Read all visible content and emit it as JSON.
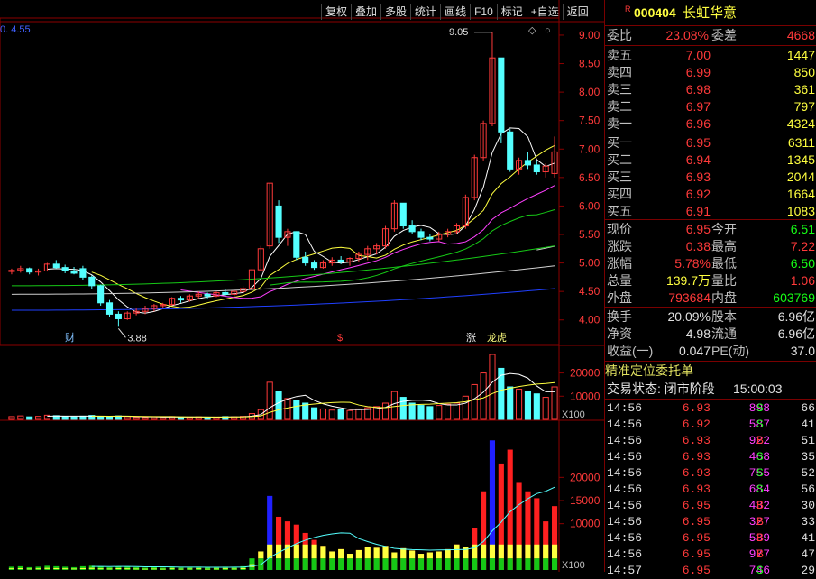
{
  "toolbar": [
    "复权",
    "叠加",
    "多股",
    "统计",
    "画线",
    "F10",
    "标记",
    "+自选",
    "返回"
  ],
  "corner_value": "0. 4.55",
  "stock": {
    "code": "000404",
    "name": "长虹华意",
    "tag": "R"
  },
  "weibi": {
    "label": "委比",
    "value": "23.08%",
    "label2": "委差",
    "value2": "4668"
  },
  "sells": [
    {
      "label": "卖五",
      "price": "7.00",
      "vol": "1447"
    },
    {
      "label": "卖四",
      "price": "6.99",
      "vol": "850"
    },
    {
      "label": "卖三",
      "price": "6.98",
      "vol": "361"
    },
    {
      "label": "卖二",
      "price": "6.97",
      "vol": "797"
    },
    {
      "label": "卖一",
      "price": "6.96",
      "vol": "4324"
    }
  ],
  "buys": [
    {
      "label": "买一",
      "price": "6.95",
      "vol": "6311"
    },
    {
      "label": "买二",
      "price": "6.94",
      "vol": "1345"
    },
    {
      "label": "买三",
      "price": "6.93",
      "vol": "2044"
    },
    {
      "label": "买四",
      "price": "6.92",
      "vol": "1664"
    },
    {
      "label": "买五",
      "price": "6.91",
      "vol": "1083"
    }
  ],
  "quote": [
    {
      "l1": "现价",
      "v1": "6.95",
      "l2": "今开",
      "v2": "6.51"
    },
    {
      "l1": "涨跌",
      "v1": "0.38",
      "l2": "最高",
      "v2": "7.22"
    },
    {
      "l1": "涨幅",
      "v1": "5.78%",
      "l2": "最低",
      "v2": "6.50"
    },
    {
      "l1": "总量",
      "v1": "139.7万",
      "l2": "量比",
      "v2": "1.06"
    },
    {
      "l1": "外盘",
      "v1": "793684",
      "l2": "内盘",
      "v2": "603769"
    }
  ],
  "fin": [
    {
      "l1": "换手",
      "v1": "20.09%",
      "l2": "股本",
      "v2": "6.96亿"
    },
    {
      "l1": "净资",
      "v1": "4.98",
      "l2": "流通",
      "v2": "6.96亿"
    },
    {
      "l1": "收益(一)",
      "v1": "0.047",
      "l2": "PE(动)",
      "v2": "37.0"
    }
  ],
  "precise_title": "精准定位委托单",
  "trade_state": {
    "label": "交易状态: 闭市阶段",
    "time": "15:00:03"
  },
  "ticks": [
    {
      "t": "14:56",
      "p": "6.93",
      "v": "898",
      "s": "S",
      "n": "66"
    },
    {
      "t": "14:56",
      "p": "6.92",
      "v": "587",
      "s": "S",
      "n": "41"
    },
    {
      "t": "14:56",
      "p": "6.93",
      "v": "922",
      "s": "B",
      "n": "51"
    },
    {
      "t": "14:56",
      "p": "6.93",
      "v": "468",
      "s": "S",
      "n": "35"
    },
    {
      "t": "14:56",
      "p": "6.93",
      "v": "755",
      "s": "S",
      "n": "52"
    },
    {
      "t": "14:56",
      "p": "6.93",
      "v": "684",
      "s": "S",
      "n": "56"
    },
    {
      "t": "14:56",
      "p": "6.95",
      "v": "432",
      "s": "B",
      "n": "30"
    },
    {
      "t": "14:56",
      "p": "6.95",
      "v": "327",
      "s": "B",
      "n": "33"
    },
    {
      "t": "14:56",
      "p": "6.95",
      "v": "539",
      "s": "B",
      "n": "41"
    },
    {
      "t": "14:56",
      "p": "6.95",
      "v": "977",
      "s": "B",
      "n": "47"
    },
    {
      "t": "14:57",
      "p": "6.95",
      "v": "746",
      "s": "S",
      "n": "29"
    }
  ],
  "price_axis": [
    "9.00",
    "8.50",
    "8.00",
    "7.50",
    "7.00",
    "6.50",
    "6.00",
    "5.50",
    "5.00",
    "4.50",
    "4.00"
  ],
  "vol_axis": [
    "20000",
    "10000"
  ],
  "vol_unit": "X100",
  "ind_axis": [
    "20000",
    "15000",
    "10000"
  ],
  "ind_unit": "X100",
  "annot": {
    "high": "9.05",
    "low": "3.88",
    "m1": "财",
    "m2": "$",
    "m3": "涨",
    "m4": "龙虎"
  },
  "chart_data": {
    "type": "candlestick",
    "ylim": [
      3.6,
      9.3
    ],
    "candles": [
      [
        4.85,
        4.9,
        4.8,
        4.87
      ],
      [
        4.87,
        4.95,
        4.83,
        4.9
      ],
      [
        4.9,
        4.92,
        4.8,
        4.84
      ],
      [
        4.84,
        4.9,
        4.78,
        4.86
      ],
      [
        4.86,
        5.0,
        4.85,
        4.98
      ],
      [
        4.98,
        5.05,
        4.9,
        4.92
      ],
      [
        4.92,
        4.97,
        4.82,
        4.86
      ],
      [
        4.86,
        4.93,
        4.8,
        4.82
      ],
      [
        4.9,
        4.95,
        4.7,
        4.75
      ],
      [
        4.75,
        4.78,
        4.55,
        4.6
      ],
      [
        4.6,
        4.62,
        4.25,
        4.3
      ],
      [
        4.3,
        4.35,
        4.05,
        4.1
      ],
      [
        4.1,
        4.15,
        3.88,
        4.02
      ],
      [
        4.02,
        4.15,
        4.0,
        4.12
      ],
      [
        4.12,
        4.2,
        4.08,
        4.15
      ],
      [
        4.15,
        4.25,
        4.1,
        4.2
      ],
      [
        4.2,
        4.28,
        4.15,
        4.25
      ],
      [
        4.25,
        4.3,
        4.2,
        4.27
      ],
      [
        4.27,
        4.4,
        4.25,
        4.38
      ],
      [
        4.38,
        4.42,
        4.3,
        4.35
      ],
      [
        4.35,
        4.45,
        4.32,
        4.42
      ],
      [
        4.42,
        4.5,
        4.38,
        4.45
      ],
      [
        4.45,
        4.48,
        4.38,
        4.42
      ],
      [
        4.42,
        4.5,
        4.4,
        4.48
      ],
      [
        4.48,
        4.55,
        4.42,
        4.45
      ],
      [
        4.45,
        4.52,
        4.4,
        4.5
      ],
      [
        4.5,
        4.6,
        4.45,
        4.55
      ],
      [
        4.55,
        4.9,
        4.5,
        4.88
      ],
      [
        4.88,
        5.3,
        4.85,
        5.25
      ],
      [
        5.3,
        6.4,
        5.25,
        6.4
      ],
      [
        6.0,
        6.1,
        5.35,
        5.45
      ],
      [
        5.45,
        5.6,
        5.3,
        5.55
      ],
      [
        5.55,
        5.5,
        5.05,
        5.1
      ],
      [
        5.1,
        5.2,
        4.95,
        5.0
      ],
      [
        5.0,
        5.05,
        4.88,
        4.92
      ],
      [
        4.92,
        5.05,
        4.9,
        5.0
      ],
      [
        5.0,
        5.1,
        4.95,
        5.05
      ],
      [
        5.05,
        5.12,
        4.98,
        5.02
      ],
      [
        5.02,
        5.1,
        4.95,
        5.08
      ],
      [
        5.08,
        5.2,
        5.02,
        5.15
      ],
      [
        5.15,
        5.3,
        5.05,
        5.25
      ],
      [
        5.25,
        5.35,
        5.15,
        5.3
      ],
      [
        5.3,
        5.65,
        5.25,
        5.6
      ],
      [
        5.6,
        6.1,
        5.55,
        6.05
      ],
      [
        6.05,
        6.0,
        5.6,
        5.65
      ],
      [
        5.65,
        5.75,
        5.5,
        5.55
      ],
      [
        5.55,
        5.6,
        5.4,
        5.45
      ],
      [
        5.45,
        5.5,
        5.38,
        5.42
      ],
      [
        5.42,
        5.55,
        5.38,
        5.5
      ],
      [
        5.5,
        5.6,
        5.45,
        5.55
      ],
      [
        5.55,
        5.7,
        5.5,
        5.65
      ],
      [
        5.65,
        6.2,
        5.6,
        6.15
      ],
      [
        6.15,
        6.9,
        6.1,
        6.85
      ],
      [
        6.85,
        7.5,
        6.8,
        7.45
      ],
      [
        7.45,
        9.05,
        7.4,
        8.6
      ],
      [
        8.6,
        8.6,
        7.1,
        7.3
      ],
      [
        7.3,
        7.35,
        6.6,
        6.65
      ],
      [
        6.65,
        6.85,
        6.55,
        6.8
      ],
      [
        6.8,
        6.95,
        6.65,
        6.72
      ],
      [
        6.72,
        6.8,
        6.55,
        6.6
      ],
      [
        6.6,
        6.75,
        6.5,
        6.7
      ],
      [
        6.57,
        7.22,
        6.5,
        6.95
      ]
    ],
    "volume_ylim": [
      0,
      28000
    ],
    "volume": [
      1200,
      1500,
      1100,
      1300,
      1800,
      1600,
      1200,
      1100,
      1400,
      1700,
      1300,
      1100,
      1500,
      1200,
      1000,
      900,
      1100,
      1000,
      1200,
      900,
      1000,
      1100,
      900,
      1000,
      1200,
      1100,
      1300,
      2500,
      4200,
      16000,
      12000,
      9000,
      8000,
      7000,
      5000,
      4500,
      4000,
      4200,
      3800,
      4500,
      5000,
      5500,
      7000,
      12000,
      9500,
      7000,
      6000,
      5500,
      6000,
      6500,
      7000,
      10000,
      15000,
      20000,
      28000,
      22000,
      14000,
      13000,
      12000,
      11000,
      9500,
      14000
    ],
    "indicator_ylim": [
      0,
      30000
    ],
    "indicator": [
      700,
      800,
      600,
      700,
      900,
      800,
      700,
      600,
      800,
      900,
      700,
      600,
      800,
      700,
      600,
      500,
      600,
      500,
      700,
      500,
      600,
      700,
      500,
      600,
      700,
      600,
      800,
      2500,
      4000,
      16000,
      11500,
      10500,
      9800,
      8000,
      6500,
      5200,
      4000,
      4500,
      3500,
      4300,
      5000,
      4800,
      5200,
      3800,
      4700,
      4200,
      3500,
      3800,
      4000,
      4500,
      5500,
      5000,
      9000,
      17000,
      28000,
      23000,
      26000,
      19000,
      17000,
      15500,
      10500,
      13800
    ]
  }
}
